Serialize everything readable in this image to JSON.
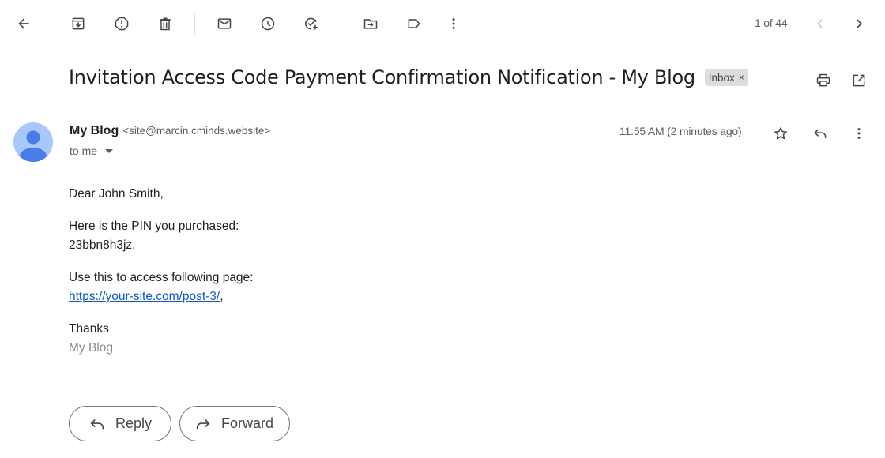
{
  "toolbar": {
    "back_icon": "arrow-left-icon",
    "actions": [
      {
        "name": "archive",
        "icon": "archive-icon"
      },
      {
        "name": "report-spam",
        "icon": "report-icon"
      },
      {
        "name": "delete",
        "icon": "trash-icon"
      },
      {
        "name": "mark-unread",
        "icon": "mail-icon"
      },
      {
        "name": "snooze",
        "icon": "clock-icon"
      },
      {
        "name": "add-to-tasks",
        "icon": "add-task-icon"
      },
      {
        "name": "move-to",
        "icon": "folder-move-icon"
      },
      {
        "name": "labels",
        "icon": "label-icon"
      },
      {
        "name": "more",
        "icon": "more-vert-icon"
      }
    ],
    "pager_text": "1 of 44"
  },
  "email": {
    "subject": "Invitation Access Code Payment Confirmation Notification - My Blog",
    "label": "Inbox",
    "label_remove": "×",
    "sender_name": "My Blog",
    "sender_email": "<site@marcin.cminds.website>",
    "recipient": "to me",
    "timestamp": "11:55 AM (2 minutes ago)",
    "body": {
      "greeting": "Dear John Smith,",
      "pin_intro": "Here is the PIN you purchased:",
      "pin": "23bbn8h3jz,",
      "access_intro": "Use this to access following page:",
      "link": "https://your-site.com/post-3/",
      "link_suffix": ",",
      "thanks": "Thanks",
      "signature": "My Blog"
    }
  },
  "actions": {
    "reply_label": "Reply",
    "forward_label": "Forward"
  }
}
